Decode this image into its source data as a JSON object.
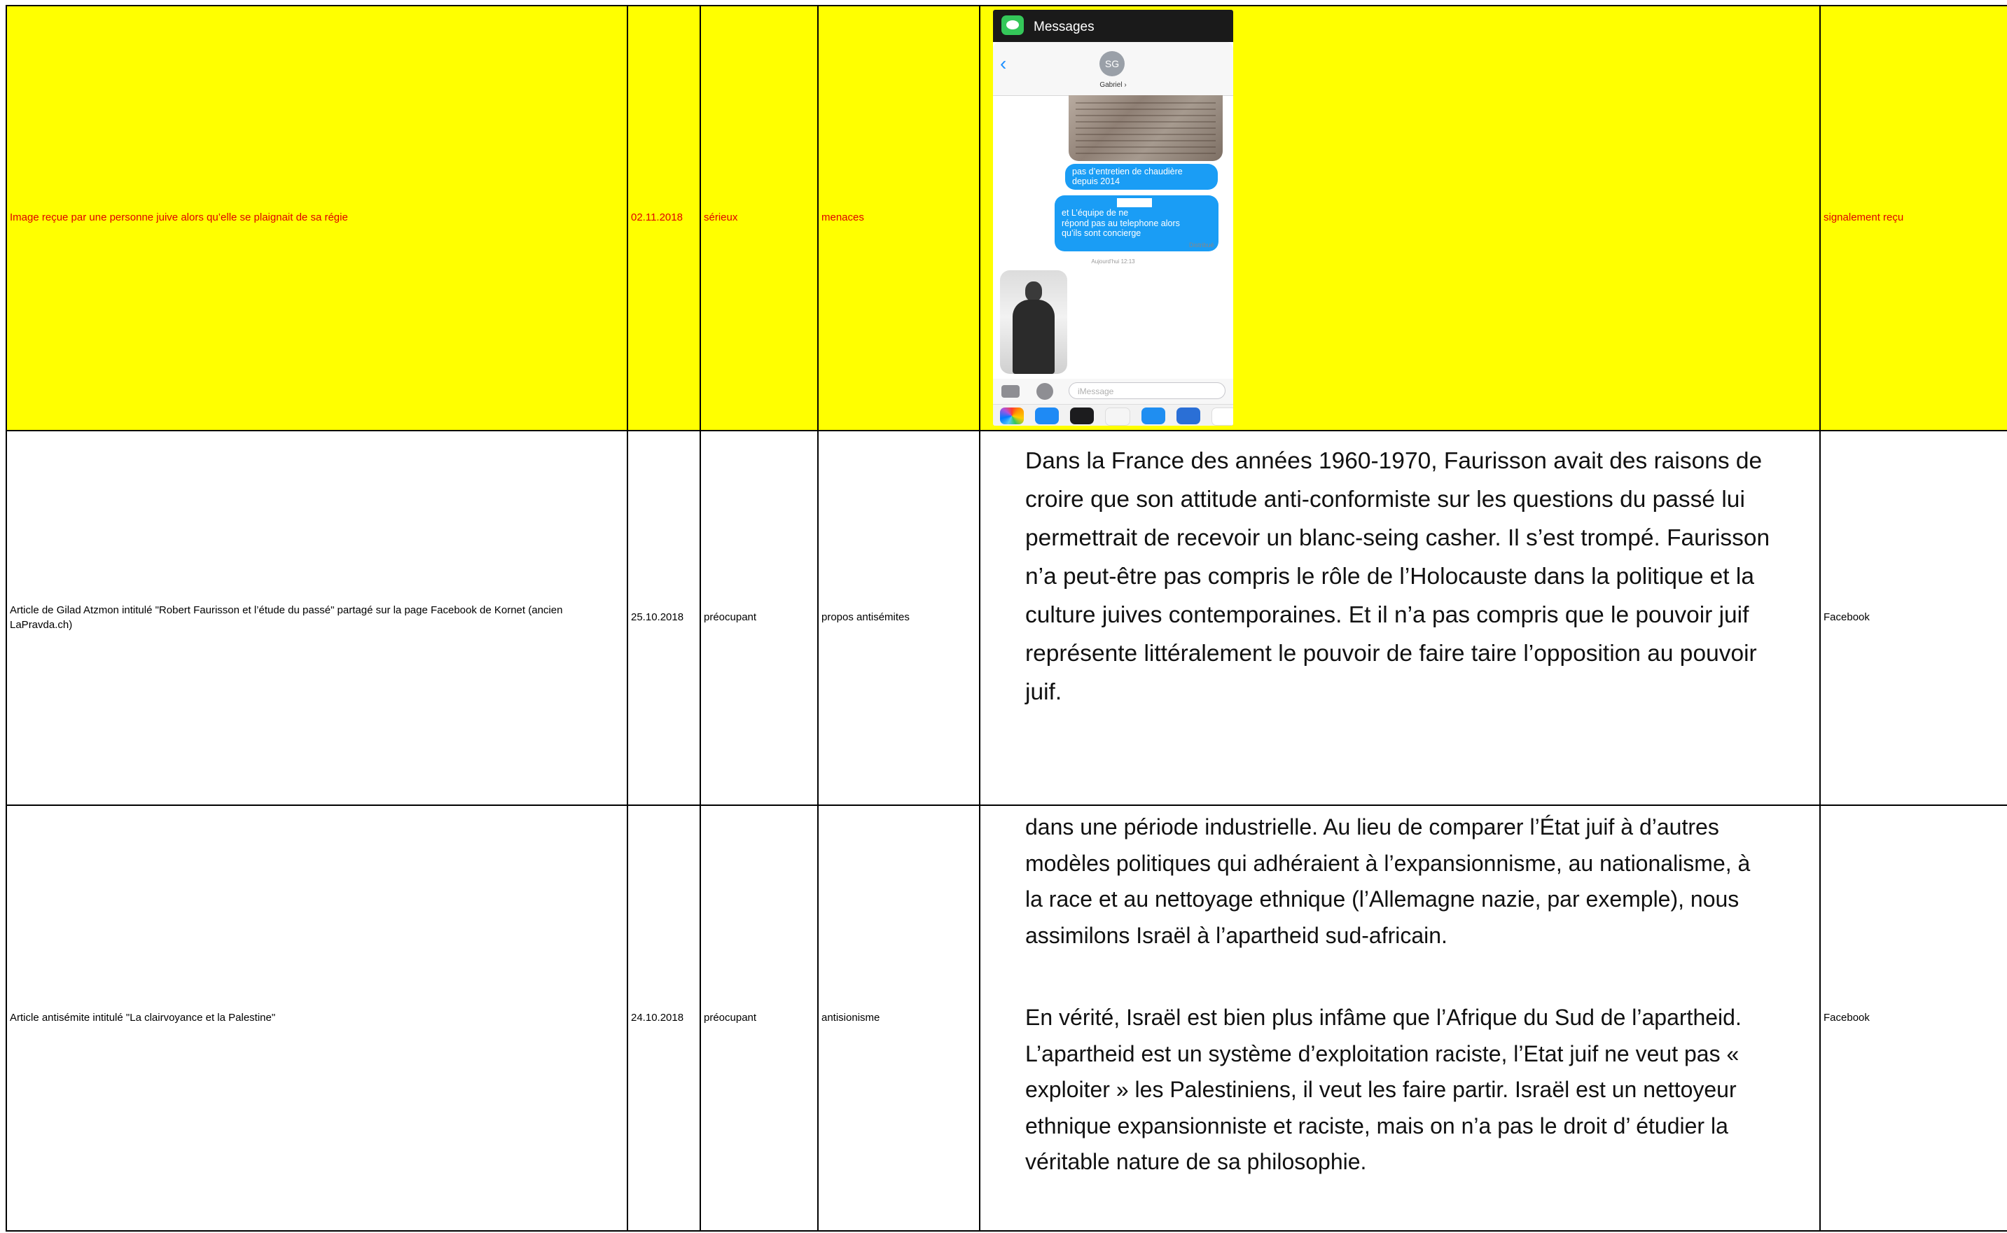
{
  "rows": [
    {
      "description": "Image reçue par une personne juive alors qu’elle se plaignait de sa régie",
      "date": "02.11.2018",
      "gravity": "sérieux",
      "category": "menaces",
      "source": "signalement reçu",
      "highlight_color": "#ffff00",
      "text_color": "#e00000",
      "phone": {
        "app_title": "Messages",
        "avatar_initials": "SG",
        "contact_name": "Gabriel ›",
        "bubble_1": "pas d’entretien de chaudière\ndepuis 2014",
        "bubble_2": "et L’équipe de              ne\nrépond pas au telephone alors\nqu’ils sont concierge",
        "delivered": "Distribué",
        "timestamp": "Aujourd’hui 12:13",
        "input_placeholder": "iMessage",
        "bubble_color": "#1a9df5"
      }
    },
    {
      "description": "Article de Gilad Atzmon intitulé \"Robert Faurisson et l’étude du passé\" partagé sur la page Facebook de Kornet (ancien LaPravda.ch)",
      "date": "25.10.2018",
      "gravity": "préocupant",
      "category": "propos antisémites",
      "source": "Facebook",
      "excerpt": "Dans la France des années 1960-1970, Faurisson avait des raisons de croire que son attitude anti-conformiste sur les questions du passé lui permettrait de recevoir un blanc-seing casher. Il s’est trompé. Faurisson n’a peut-être pas compris le rôle de l’Holocauste dans la politique et la culture juives contemporaines. Et il n’a pas compris que le pouvoir juif représente littéralement le pouvoir de faire taire l’opposition au pouvoir juif."
    },
    {
      "description": "Article antisémite intitulé \"La clairvoyance et la Palestine\"",
      "date": "24.10.2018",
      "gravity": "préocupant",
      "category": "antisionisme",
      "source": "Facebook",
      "excerpt_1": "dans une période industrielle. Au lieu de comparer l’État juif à d’autres modèles politiques qui adhéraient à l’expansionnisme, au nationalisme, à la race et au nettoyage ethnique (l’Allemagne nazie, par exemple), nous assimilons Israël à l’apartheid sud-africain.",
      "excerpt_2": "En vérité, Israël est bien plus infâme que l’Afrique du Sud de l’apartheid. L’apartheid est un système d’exploitation raciste, l’Etat juif ne veut pas « exploiter » les Palestiniens, il veut les faire partir. Israël est un nettoyeur ethnique expansionniste et raciste, mais on n’a pas le droit d’ étudier la véritable nature de sa philosophie."
    }
  ]
}
